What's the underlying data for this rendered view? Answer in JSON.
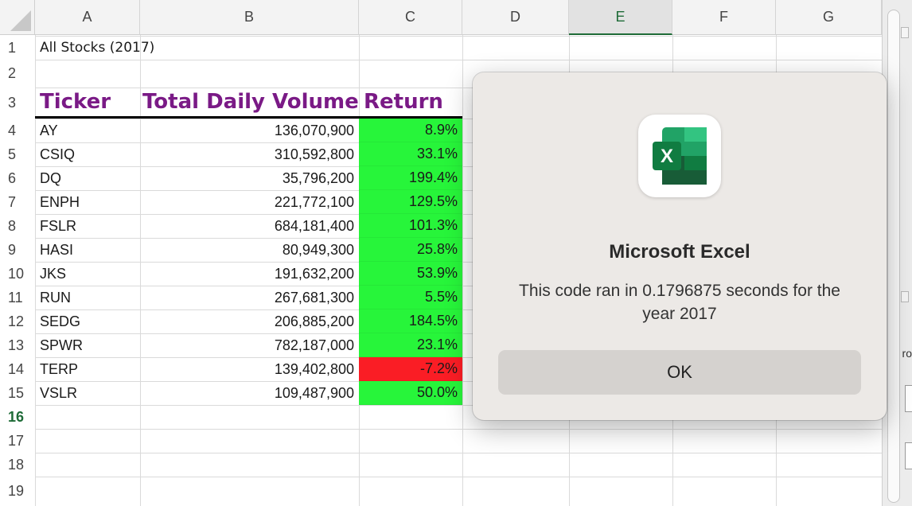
{
  "columns": [
    "A",
    "B",
    "C",
    "D",
    "E",
    "F",
    "G"
  ],
  "selected_column": "E",
  "rows": [
    "1",
    "2",
    "3",
    "4",
    "5",
    "6",
    "7",
    "8",
    "9",
    "10",
    "11",
    "12",
    "13",
    "14",
    "15",
    "16",
    "17",
    "18",
    "19"
  ],
  "selected_row": "16",
  "sheet": {
    "title": "All Stocks (2017)",
    "headers": {
      "ticker": "Ticker",
      "volume": "Total Daily Volume",
      "return": "Return"
    },
    "data": [
      {
        "ticker": "AY",
        "volume": "136,070,900",
        "return": "8.9%"
      },
      {
        "ticker": "CSIQ",
        "volume": "310,592,800",
        "return": "33.1%"
      },
      {
        "ticker": "DQ",
        "volume": "35,796,200",
        "return": "199.4%"
      },
      {
        "ticker": "ENPH",
        "volume": "221,772,100",
        "return": "129.5%"
      },
      {
        "ticker": "FSLR",
        "volume": "684,181,400",
        "return": "101.3%"
      },
      {
        "ticker": "HASI",
        "volume": "80,949,300",
        "return": "25.8%"
      },
      {
        "ticker": "JKS",
        "volume": "191,632,200",
        "return": "53.9%"
      },
      {
        "ticker": "RUN",
        "volume": "267,681,300",
        "return": "5.5%"
      },
      {
        "ticker": "SEDG",
        "volume": "206,885,200",
        "return": "184.5%"
      },
      {
        "ticker": "SPWR",
        "volume": "782,187,000",
        "return": "23.1%"
      },
      {
        "ticker": "TERP",
        "volume": "139,402,800",
        "return": "-7.2%"
      },
      {
        "ticker": "VSLR",
        "volume": "109,487,900",
        "return": "50.0%"
      }
    ]
  },
  "colors": {
    "positive_fill": "#27f53a",
    "negative_fill": "#fa1d25",
    "header_text": "#7a1a86",
    "selected_header": "#1e6b37"
  },
  "dialog": {
    "icon": "microsoft-excel-icon",
    "title": "Microsoft Excel",
    "message": "This code ran in 0.1796875 seconds for the year 2017",
    "ok_label": "OK"
  },
  "side_panel": {
    "label": "ro"
  }
}
